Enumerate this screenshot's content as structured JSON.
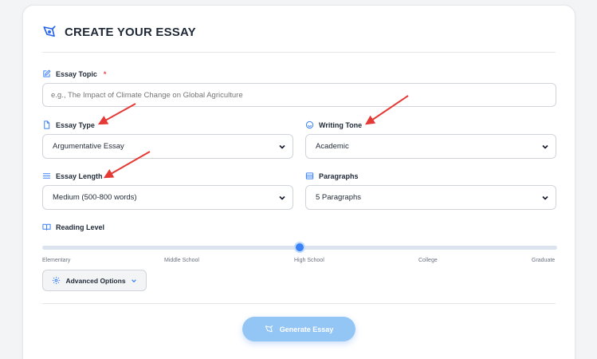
{
  "header": {
    "title": "CREATE YOUR ESSAY",
    "icon": "pen-nib-icon"
  },
  "topic": {
    "label": "Essay Topic",
    "required_mark": "*",
    "placeholder": "e.g., The Impact of Climate Change on Global Agriculture",
    "value": ""
  },
  "essay_type": {
    "label": "Essay Type",
    "value": "Argumentative Essay"
  },
  "writing_tone": {
    "label": "Writing Tone",
    "value": "Academic"
  },
  "essay_length": {
    "label": "Essay Length",
    "value": "Medium (500-800 words)"
  },
  "paragraphs": {
    "label": "Paragraphs",
    "value": "5 Paragraphs"
  },
  "reading_level": {
    "label": "Reading Level",
    "ticks": [
      "Elementary",
      "Middle School",
      "High School",
      "College",
      "Graduate"
    ],
    "selected_index": 2,
    "fraction": 0.5
  },
  "advanced": {
    "label": "Advanced Options"
  },
  "generate": {
    "label": "Generate Essay"
  },
  "colors": {
    "accent": "#3b82f6",
    "annotation_arrow": "#e53935",
    "required": "#ef4444",
    "generate_button": "#93c5f5"
  }
}
